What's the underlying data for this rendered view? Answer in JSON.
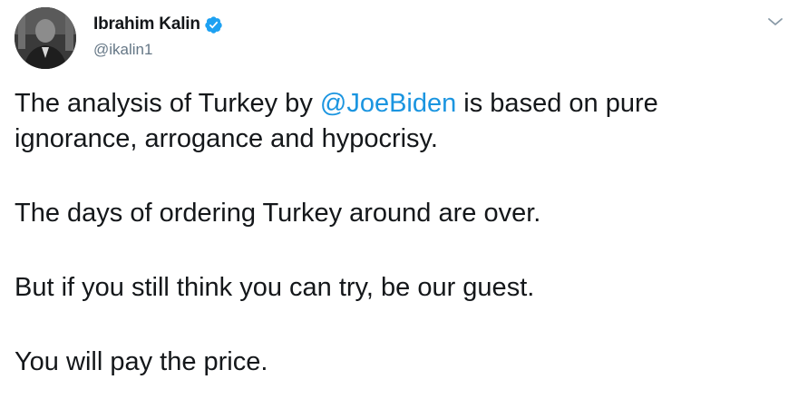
{
  "author": {
    "display_name": "Ibrahim Kalin",
    "handle": "@ikalin1",
    "verified": true,
    "avatar_icon": "profile-photo",
    "verified_icon": "verified-badge-icon"
  },
  "menu": {
    "icon": "chevron-down-icon"
  },
  "tweet": {
    "p1_before": "The analysis of Turkey by ",
    "p1_mention": "@JoeBiden",
    "p1_after": " is based on pure ignorance, arrogance and hypocrisy.",
    "p2": "The days of ordering Turkey around are over.",
    "p3": "But if you still think you can try, be our guest.",
    "p4": "You will pay the price."
  },
  "colors": {
    "link": "#1b95e0",
    "verified": "#1da1f2",
    "secondary_text": "#657786",
    "primary_text": "#14171a"
  }
}
